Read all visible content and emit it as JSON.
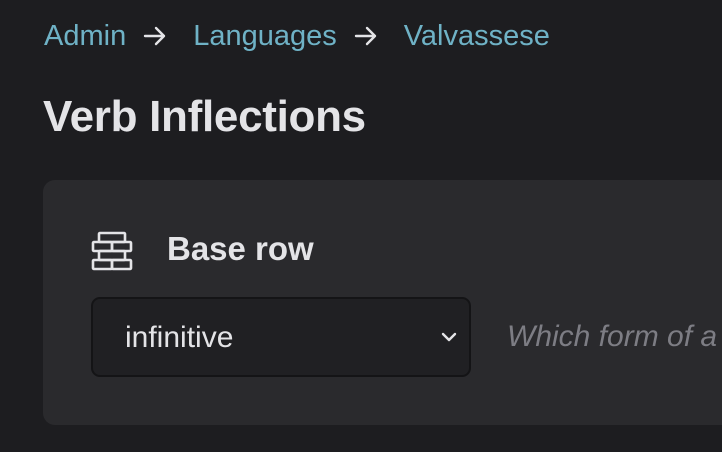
{
  "breadcrumb": {
    "items": [
      "Admin",
      "Languages",
      "Valvassese"
    ],
    "separator_icon": "arrow-right-icon"
  },
  "page": {
    "title": "Verb Inflections"
  },
  "base_row": {
    "icon": "brick-wall-icon",
    "label": "Base row",
    "selected_value": "infinitive",
    "help_text": "Which form of a"
  },
  "colors": {
    "background": "#1d1d20",
    "card": "#2a2a2d",
    "link": "#6fb2c6",
    "text": "#e4e4e7",
    "muted": "#7d7d84"
  }
}
